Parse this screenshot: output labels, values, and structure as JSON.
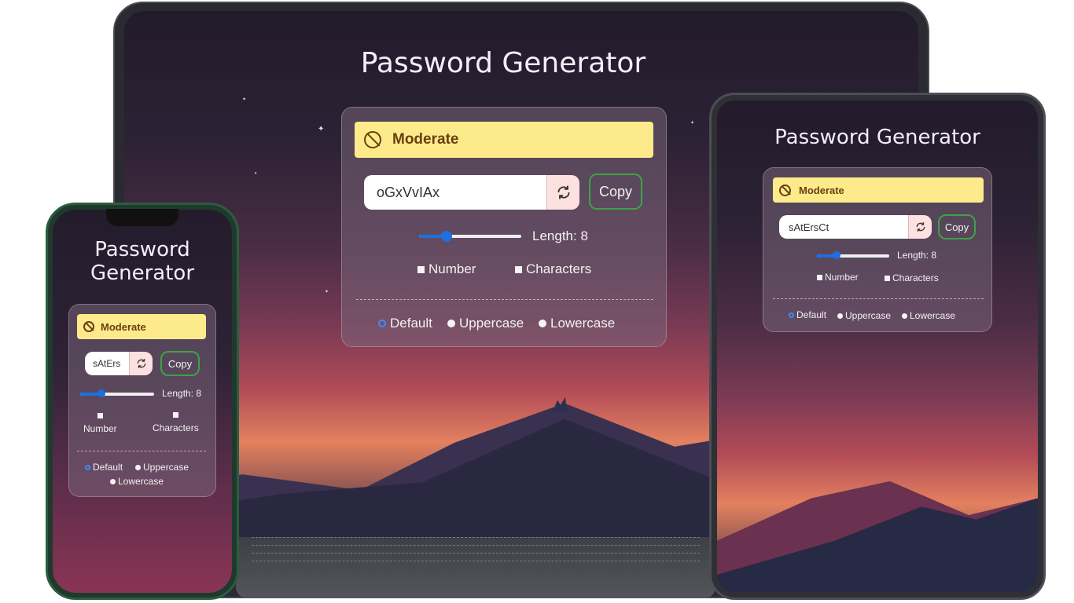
{
  "laptop": {
    "title": "Password Generator",
    "strength_label": "Moderate",
    "password": "oGxVvIAx",
    "copy_label": "Copy",
    "length_label": "Length: 8",
    "length_value": 8,
    "checkboxes": [
      "Number",
      "Characters"
    ],
    "radios": [
      "Default",
      "Uppercase",
      "Lowercase"
    ],
    "selected_radio": "Default"
  },
  "tablet": {
    "title": "Password Generator",
    "strength_label": "Moderate",
    "password": "sAtErsCt",
    "copy_label": "Copy",
    "length_label": "Length: 8",
    "length_value": 8,
    "checkboxes": [
      "Number",
      "Characters"
    ],
    "radios": [
      "Default",
      "Uppercase",
      "Lowercase"
    ],
    "selected_radio": "Default"
  },
  "phone": {
    "title_line1": "Password",
    "title_line2": "Generator",
    "strength_label": "Moderate",
    "password": "sAtErs",
    "copy_label": "Copy",
    "length_label": "Length: 8",
    "length_value": 8,
    "checkboxes": [
      "Number",
      "Characters"
    ],
    "radios": [
      "Default",
      "Uppercase",
      "Lowercase"
    ],
    "selected_radio": "Default"
  },
  "colors": {
    "strength_bg": "#fdeb8b",
    "copy_border": "#3fa14a",
    "slider_accent": "#1e6fe0",
    "refresh_bg": "#fde0e0"
  },
  "icons": {
    "strength": "ban-icon",
    "refresh": "refresh-icon"
  }
}
